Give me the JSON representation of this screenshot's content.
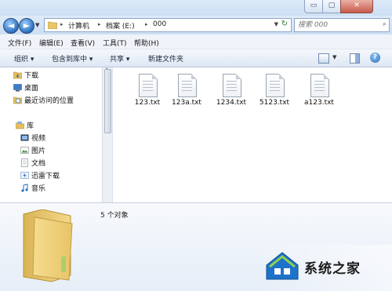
{
  "window_controls": {
    "minimize": "▭",
    "maximize": "▢",
    "close": "✕"
  },
  "nav": {
    "back": "◄",
    "forward": "►",
    "address_path": [
      "计算机",
      "档案 (E:)",
      "000"
    ],
    "refresh": "↻",
    "search_placeholder": "搜索 000",
    "search_icon": "magnifier-icon"
  },
  "menu": [
    "文件(F)",
    "编辑(E)",
    "查看(V)",
    "工具(T)",
    "帮助(H)"
  ],
  "toolbar": {
    "organize": "组织 ▾",
    "include_library": "包含到库中 ▾",
    "share": "共享 ▾",
    "new_folder": "新建文件夹"
  },
  "sidebar": {
    "favorites": [
      {
        "label": "下载",
        "icon": "download-folder-icon"
      },
      {
        "label": "桌面",
        "icon": "desktop-icon"
      },
      {
        "label": "最近访问的位置",
        "icon": "recent-places-icon"
      }
    ],
    "libraries": {
      "label": "库",
      "icon": "library-icon"
    },
    "library_items": [
      {
        "label": "视频",
        "icon": "video-icon"
      },
      {
        "label": "图片",
        "icon": "picture-icon"
      },
      {
        "label": "文档",
        "icon": "document-icon"
      },
      {
        "label": "迅雷下载",
        "icon": "thunder-download-icon"
      },
      {
        "label": "音乐",
        "icon": "music-icon"
      }
    ]
  },
  "files": [
    "123.txt",
    "123a.txt",
    "1234.txt",
    "5123.txt",
    "a123.txt"
  ],
  "details": {
    "count": "5 个对象"
  },
  "watermark": {
    "text": "系统之家"
  }
}
